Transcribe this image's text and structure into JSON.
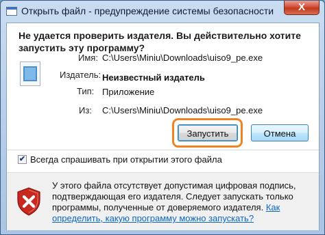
{
  "window": {
    "title": "Открыть файл - предупреждение системы безопасности",
    "close_label": "X"
  },
  "dialog": {
    "heading": "Не удается проверить издателя.  Вы действительно хотите запустить эту программу?",
    "fields": {
      "name_label": "Имя:",
      "name_value": "C:\\Users\\Miniu\\Downloads\\uiso9_pe.exe",
      "publisher_label": "Издатель:",
      "publisher_value": "Неизвестный издатель",
      "type_label": "Тип:",
      "type_value": "Приложение",
      "from_label": "Из:",
      "from_value": "C:\\Users\\Miniu\\Downloads\\uiso9_pe.exe"
    },
    "buttons": {
      "run_label": "Запустить",
      "cancel_label": "Отмена"
    },
    "checkbox": {
      "label": "Всегда спрашивать при открытии этого файла",
      "checked": true,
      "mark": "✔"
    },
    "warning": {
      "text": "У этого файла отсутствует допустимая цифровая подпись, подтверждающая его издателя. Следует запускать только программы, полученные от доверяемого издателя. ",
      "link": "Как определить, какую программу можно запускать?"
    }
  },
  "colors": {
    "focus_ring": "#ee8322",
    "link": "#0c66c7",
    "shield_red": "#c8291e"
  },
  "icons": [
    "application-icon",
    "close-icon",
    "file-icon",
    "checkmark-icon",
    "security-shield-icon"
  ]
}
